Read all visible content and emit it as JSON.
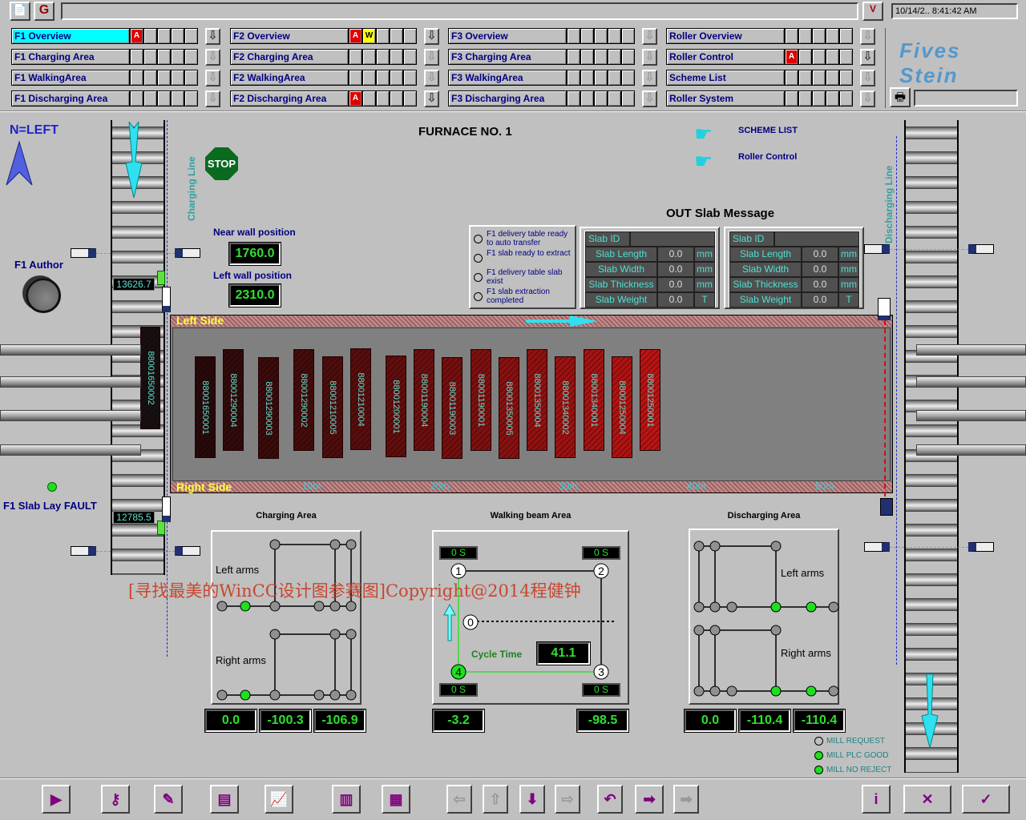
{
  "header": {
    "title_field": "",
    "datetime": "10/14/2..   8:41:42 AM",
    "logo_text": "Fives Stein",
    "print_field": ""
  },
  "nav": [
    [
      {
        "label": "F1  Overview",
        "active": true,
        "flags": [
          "A",
          "",
          "",
          "",
          ""
        ]
      },
      {
        "label": "F1  Charging Area",
        "flags": [
          "",
          "",
          "",
          "",
          ""
        ]
      },
      {
        "label": "F1  WalkingArea",
        "flags": [
          "",
          "",
          "",
          "",
          ""
        ]
      },
      {
        "label": "F1  Discharging Area",
        "flags": [
          "",
          "",
          "",
          "",
          ""
        ]
      }
    ],
    [
      {
        "label": "F2  Overview",
        "flags": [
          "A",
          "W",
          "",
          "",
          ""
        ]
      },
      {
        "label": "F2  Charging Area",
        "flags": [
          "",
          "",
          "",
          "",
          ""
        ]
      },
      {
        "label": "F2  WalkingArea",
        "flags": [
          "",
          "",
          "",
          "",
          ""
        ]
      },
      {
        "label": "F2  Discharging Area",
        "flags": [
          "A",
          "",
          "",
          "",
          ""
        ]
      }
    ],
    [
      {
        "label": "F3  Overview",
        "flags": [
          "",
          "",
          "",
          "",
          ""
        ]
      },
      {
        "label": "F3  Charging Area",
        "flags": [
          "",
          "",
          "",
          "",
          ""
        ]
      },
      {
        "label": "F3  WalkingArea",
        "flags": [
          "",
          "",
          "",
          "",
          ""
        ]
      },
      {
        "label": "F3  Discharging Area",
        "flags": [
          "",
          "",
          "",
          "",
          ""
        ]
      }
    ],
    [
      {
        "label": "Roller  Overview",
        "flags": [
          "",
          "",
          "",
          "",
          ""
        ]
      },
      {
        "label": "Roller  Control",
        "flags": [
          "A",
          "",
          "",
          "",
          ""
        ]
      },
      {
        "label": "Scheme  List",
        "flags": [
          "",
          "",
          "",
          "",
          ""
        ]
      },
      {
        "label": "Roller  System",
        "flags": [
          "",
          "",
          "",
          "",
          ""
        ]
      }
    ]
  ],
  "colors": {
    "alarm": "#e00000",
    "warning": "#ffff00",
    "active_tab": "#00ffff",
    "display_text": "#2ee02e",
    "id_text": "#5fe0d0"
  },
  "main": {
    "north": "N=LEFT",
    "furnace_title": "FURNACE NO. 1",
    "f1_author": "F1 Author",
    "slab_lay_fault": "F1 Slab Lay FAULT",
    "charging_line": "Charging Line",
    "discharging_line": "Discharging Line",
    "stop": "STOP",
    "near_wall_label": "Near wall position",
    "near_wall_value": "1760.0",
    "left_wall_label": "Left wall position",
    "left_wall_value": "2310.0",
    "charging_readout_top": "13626.7",
    "charging_readout_bottom": "12785.5",
    "scheme_list": "SCHEME LIST",
    "roller_control": "Roller Control",
    "left_side": "Left Side",
    "right_side": "Right Side",
    "scale": [
      "10m",
      "20m",
      "30m",
      "40m",
      "50m"
    ],
    "charging_slab": "88001650002",
    "slabs": [
      "88001650001",
      "88001290004",
      "88001290003",
      "88001290002",
      "88001210005",
      "88001210004",
      "88001200001",
      "88001190004",
      "88001190003",
      "88001190001",
      "88001350005",
      "88001350004",
      "88001340002",
      "88001340001",
      "88001250004",
      "88001250001"
    ],
    "status_items": [
      "F1 delivery table ready to auto transfer",
      "F1 slab ready to extract",
      "F1 delivery table slab exist",
      "F1 slab extraction completed"
    ],
    "out_title": "OUT Slab Message",
    "out_tables": [
      {
        "id_label": "Slab ID",
        "id_value": "",
        "rows": [
          {
            "label": "Slab Length",
            "value": "0.0",
            "unit": "mm"
          },
          {
            "label": "Slab Width",
            "value": "0.0",
            "unit": "mm"
          },
          {
            "label": "Slab Thickness",
            "value": "0.0",
            "unit": "mm"
          },
          {
            "label": "Slab Weight",
            "value": "0.0",
            "unit": "T"
          }
        ]
      },
      {
        "id_label": "Slab ID",
        "id_value": "",
        "rows": [
          {
            "label": "Slab Length",
            "value": "0.0",
            "unit": "mm"
          },
          {
            "label": "Slab Width",
            "value": "0.0",
            "unit": "mm"
          },
          {
            "label": "Slab Thickness",
            "value": "0.0",
            "unit": "mm"
          },
          {
            "label": "Slab Weight",
            "value": "0.0",
            "unit": "T"
          }
        ]
      }
    ],
    "charging": {
      "title": "Charging Area",
      "left_arms": "Left arms",
      "right_arms": "Right arms",
      "readouts": [
        "0.0",
        "-100.3",
        "-106.9"
      ]
    },
    "walking": {
      "title": "Walking beam Area",
      "timers": [
        "0  S",
        "0  S",
        "0  S",
        "0  S"
      ],
      "cycle_label": "Cycle Time",
      "cycle_value": "41.1",
      "points": [
        "1",
        "2",
        "0",
        "3",
        "4"
      ],
      "readouts": [
        "-3.2",
        "-98.5"
      ]
    },
    "discharging": {
      "title": "Discharging Area",
      "left_arms": "Left arms",
      "right_arms": "Right arms",
      "readouts": [
        "0.0",
        "-110.4",
        "-110.4"
      ]
    },
    "legend": [
      {
        "label": "MILL REQUEST",
        "on": false
      },
      {
        "label": "MILL PLC GOOD",
        "on": true
      },
      {
        "label": "MILL NO REJECT",
        "on": true
      }
    ],
    "watermark": "[寻找最美的WinCC设计图参赛图]Copyright@2014程健钟"
  },
  "toolbar": [
    {
      "name": "start-button",
      "icon": "▶"
    },
    {
      "name": "login-key-button",
      "icon": "⚷"
    },
    {
      "name": "report-button",
      "icon": "✎"
    },
    {
      "name": "print-report-button",
      "icon": "▤"
    },
    {
      "name": "trend-button",
      "icon": "📈"
    },
    {
      "name": "config-t-button",
      "icon": "▥"
    },
    {
      "name": "config-p-button",
      "icon": "▦"
    },
    {
      "name": "left-arrow-button",
      "icon": "⇦"
    },
    {
      "name": "up-arrow-button",
      "icon": "⇧"
    },
    {
      "name": "down-arrow-button",
      "icon": "⬇"
    },
    {
      "name": "right-arrow-button",
      "icon": "⇨"
    },
    {
      "name": "undo-button",
      "icon": "↶"
    },
    {
      "name": "forward-step-button",
      "icon": "➡"
    },
    {
      "name": "forward-disabled-button",
      "icon": "➡"
    },
    {
      "name": "info-button",
      "icon": "i"
    },
    {
      "name": "mute-button",
      "icon": "✕"
    },
    {
      "name": "exit-button",
      "icon": "✓"
    }
  ]
}
